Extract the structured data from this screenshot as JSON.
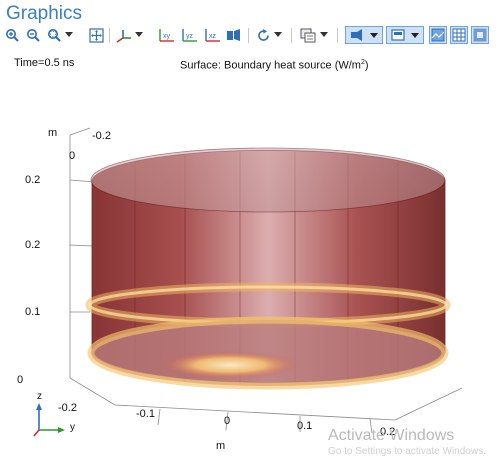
{
  "window": {
    "title": "Graphics"
  },
  "toolbar": {
    "icons": [
      "zoom-in-icon",
      "zoom-out-icon",
      "zoom-box-icon",
      "zoom-extents-icon",
      "axis-orientation-icon",
      "view-xy-icon",
      "view-yz-icon",
      "view-zx-icon",
      "go-to-view-icon",
      "rotate-icon",
      "copy-image-icon",
      "camera-icon",
      "scene-light-icon",
      "grid-icon",
      "render-icon",
      "transparency-icon"
    ],
    "view_xy": "xy",
    "view_yz": "yz",
    "view_zx": "xz"
  },
  "plot": {
    "time": "Time=0.5 ns",
    "surface_label": "Surface: Boundary heat source (W/m",
    "surface_label_sup": "2",
    "surface_label_end": ")"
  },
  "axes": {
    "z_unit": "m",
    "z_ticks": [
      "0.2",
      "0.2",
      "0.1",
      "0"
    ],
    "top_ticks": [
      "-0.2",
      "0"
    ],
    "x_ticks": [
      "-0.2",
      "-0.1",
      "0",
      "0.1",
      "0.2"
    ],
    "x_unit": "m",
    "triad_z": "z",
    "triad_y": "y"
  },
  "overlay": {
    "watermark": "Activate Windows",
    "watermark_sub": "Go to Settings to activate Windows."
  },
  "colors": {
    "cylinder": "#8b2e2e",
    "hot": "#ffe7a8",
    "accent": "#3a7fc2"
  }
}
